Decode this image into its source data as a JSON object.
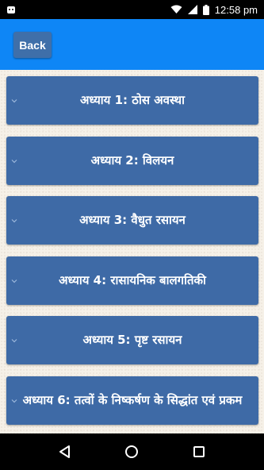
{
  "status_bar": {
    "time": "12:58",
    "time_suffix": "pm"
  },
  "app_bar": {
    "back_label": "Back"
  },
  "chapters": [
    {
      "label": "अध्याय 1: ठोस अवस्था"
    },
    {
      "label": "अध्याय 2: विलयन"
    },
    {
      "label": "अध्याय 3: वैधुत रसायन"
    },
    {
      "label": "अध्याय 4: रासायनिक बालगतिकी"
    },
    {
      "label": "अध्याय 5: पृष्ट रसायन"
    },
    {
      "label": "अध्याय 6: तत्वों के निष्कर्षण के सिद्धांत एवं प्रकम"
    }
  ],
  "colors": {
    "app_bar": "#0e86f6",
    "chapter_button": "#3e6aa6",
    "back_button": "#3f6fa9",
    "background": "#f6f1e8"
  },
  "icons": {
    "notification": "android-notification-icon",
    "wifi": "wifi-icon",
    "signal": "cell-signal-icon",
    "battery": "battery-icon",
    "chapter_expand": "chevron-down-icon",
    "nav_back": "triangle-back-icon",
    "nav_home": "circle-home-icon",
    "nav_recents": "square-recents-icon"
  }
}
